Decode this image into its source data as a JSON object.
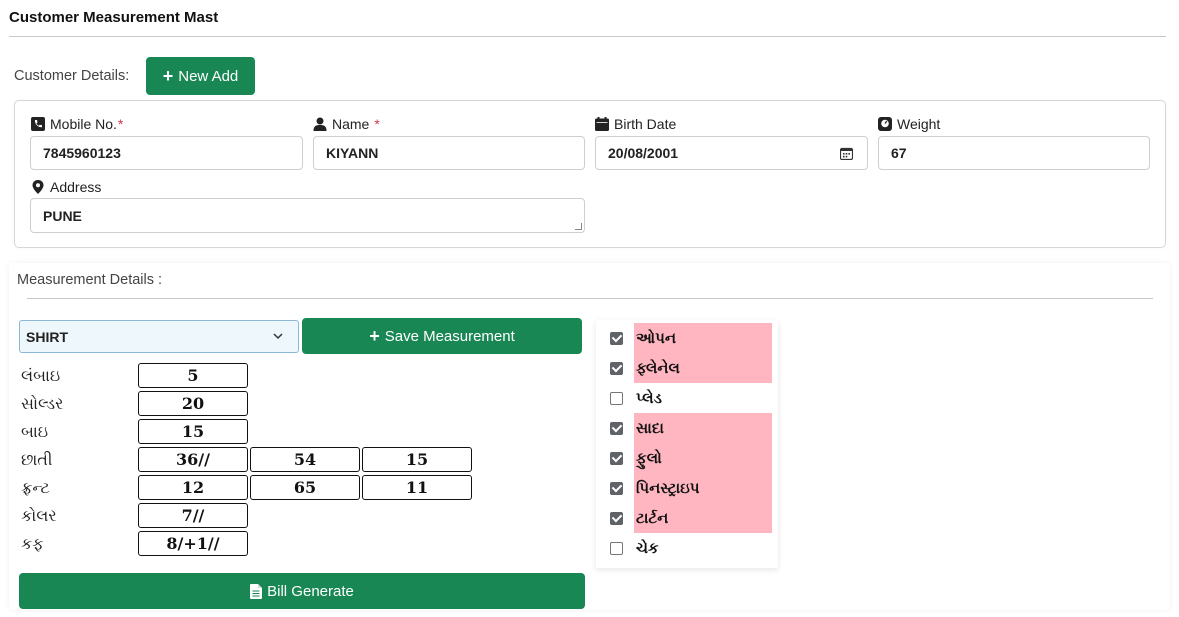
{
  "page": {
    "title": "Customer Measurement Mast"
  },
  "customer": {
    "section_label": "Customer Details:",
    "new_add_label": "New Add",
    "mobile": {
      "label": "Mobile No.",
      "required_mark": "*",
      "value": "7845960123"
    },
    "name": {
      "label": "Name",
      "required_mark": "*",
      "value": "KIYANN"
    },
    "birth_date": {
      "label": "Birth Date",
      "value": "20/08/2001"
    },
    "weight": {
      "label": "Weight",
      "value": "67"
    },
    "address": {
      "label": "Address",
      "value": "PUNE"
    }
  },
  "measurement": {
    "section_label": "Measurement Details :",
    "garment_selected": "SHIRT",
    "save_label": "Save Measurement",
    "bill_label": "Bill Generate",
    "rows": [
      {
        "label": "લંબાઇ",
        "values": [
          "5"
        ]
      },
      {
        "label": "સોલ્ડર",
        "values": [
          "20"
        ]
      },
      {
        "label": "બાઇ",
        "values": [
          "15"
        ]
      },
      {
        "label": "છાતી",
        "values": [
          "36//",
          "54",
          "15"
        ]
      },
      {
        "label": "ફ્રન્ટ",
        "values": [
          "12",
          "65",
          "11"
        ]
      },
      {
        "label": "કોલર",
        "values": [
          "7//"
        ]
      },
      {
        "label": "કફ",
        "values": [
          "8/+1//"
        ]
      }
    ],
    "options": [
      {
        "label": "ઓપન",
        "checked": true
      },
      {
        "label": "ફ્લેનેલ",
        "checked": true
      },
      {
        "label": "પ્લેડ",
        "checked": false
      },
      {
        "label": "સાદા",
        "checked": true
      },
      {
        "label": "ફુલો",
        "checked": true
      },
      {
        "label": "પિનસ્ટ્રાઇપ",
        "checked": true
      },
      {
        "label": "ટાર્ટન",
        "checked": true
      },
      {
        "label": "ચેક",
        "checked": false
      }
    ]
  },
  "colors": {
    "primary_green": "#198754",
    "highlight_pink": "#ffb6c1"
  }
}
